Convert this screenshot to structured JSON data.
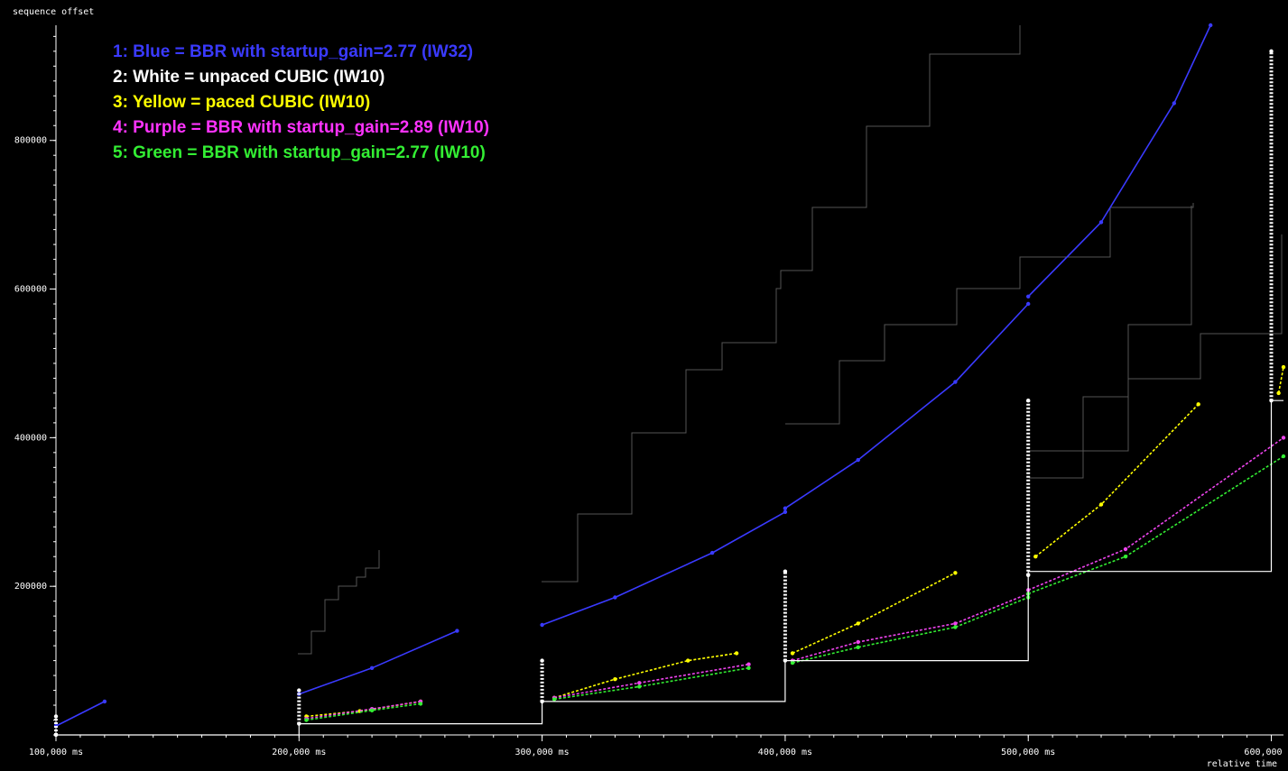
{
  "chart_data": {
    "type": "line",
    "title": "",
    "ylabel": "sequence offset",
    "xlabel": "relative time",
    "xlim": [
      100000,
      605000
    ],
    "ylim": [
      0,
      955000
    ],
    "x_ticks": [
      {
        "value": 100000,
        "label": "100,000 ms"
      },
      {
        "value": 200000,
        "label": "200,000 ms"
      },
      {
        "value": 300000,
        "label": "300,000 ms"
      },
      {
        "value": 400000,
        "label": "400,000 ms"
      },
      {
        "value": 500000,
        "label": "500,000 ms"
      },
      {
        "value": 600000,
        "label": "600,000 ms"
      }
    ],
    "y_ticks": [
      {
        "value": 200000,
        "label": "200000"
      },
      {
        "value": 400000,
        "label": "400000"
      },
      {
        "value": 600000,
        "label": "600000"
      },
      {
        "value": 800000,
        "label": "800000"
      }
    ],
    "legend": [
      {
        "text": "1: Blue = BBR with startup_gain=2.77 (IW32)",
        "color": "#4040ff"
      },
      {
        "text": "2: White = unpaced CUBIC (IW10)",
        "color": "#ffffff"
      },
      {
        "text": "3: Yellow = paced CUBIC (IW10)",
        "color": "#ffff00"
      },
      {
        "text": "4: Purple = BBR with startup_gain=2.89 (IW10)",
        "color": "#ff33ff"
      },
      {
        "text": "5: Green = BBR with startup_gain=2.77 (IW10)",
        "color": "#33ee33"
      }
    ],
    "series": [
      {
        "name": "1: Blue = BBR with startup_gain=2.77 (IW32)",
        "color": "#3a3aff",
        "segments": [
          [
            [
              100000,
              12000
            ],
            [
              120000,
              45000
            ]
          ],
          [
            [
              200000,
              55000
            ],
            [
              230000,
              90000
            ],
            [
              265000,
              140000
            ]
          ],
          [
            [
              300000,
              148000
            ],
            [
              330000,
              185000
            ],
            [
              370000,
              245000
            ],
            [
              400000,
              300000
            ]
          ],
          [
            [
              400000,
              305000
            ],
            [
              430000,
              370000
            ],
            [
              470000,
              475000
            ],
            [
              500000,
              580000
            ]
          ],
          [
            [
              500000,
              590000
            ],
            [
              530000,
              690000
            ],
            [
              560000,
              850000
            ],
            [
              575000,
              955000
            ]
          ]
        ]
      },
      {
        "name": "2: White = unpaced CUBIC (IW10)",
        "color": "#ffffff",
        "segments": [
          [
            [
              100000,
              0
            ],
            [
              100000,
              25000
            ]
          ],
          [
            [
              200000,
              15000
            ],
            [
              200000,
              60000
            ]
          ],
          [
            [
              300000,
              45000
            ],
            [
              300000,
              100000
            ]
          ],
          [
            [
              400000,
              100000
            ],
            [
              400000,
              220000
            ]
          ],
          [
            [
              500000,
              215000
            ],
            [
              500000,
              450000
            ]
          ],
          [
            [
              600000,
              450000
            ],
            [
              600000,
              920000
            ]
          ]
        ]
      },
      {
        "name": "3: Yellow = paced CUBIC (IW10)",
        "color": "#ffff00",
        "segments": [
          [
            [
              203000,
              25000
            ],
            [
              225000,
              32000
            ],
            [
              250000,
              45000
            ]
          ],
          [
            [
              305000,
              50000
            ],
            [
              330000,
              75000
            ],
            [
              360000,
              100000
            ],
            [
              380000,
              110000
            ]
          ],
          [
            [
              403000,
              110000
            ],
            [
              430000,
              150000
            ],
            [
              470000,
              218000
            ]
          ],
          [
            [
              503000,
              240000
            ],
            [
              530000,
              310000
            ],
            [
              570000,
              445000
            ]
          ],
          [
            [
              603000,
              460000
            ],
            [
              605000,
              495000
            ]
          ]
        ]
      },
      {
        "name": "4: Purple = BBR with startup_gain=2.89 (IW10)",
        "color": "#ee44ee",
        "segments": [
          [
            [
              203000,
              22000
            ],
            [
              230000,
              35000
            ],
            [
              250000,
              45000
            ]
          ],
          [
            [
              305000,
              50000
            ],
            [
              340000,
              70000
            ],
            [
              385000,
              95000
            ]
          ],
          [
            [
              403000,
              100000
            ],
            [
              430000,
              125000
            ],
            [
              470000,
              150000
            ],
            [
              500000,
              190000
            ]
          ],
          [
            [
              500000,
              195000
            ],
            [
              540000,
              250000
            ],
            [
              605000,
              400000
            ]
          ]
        ]
      },
      {
        "name": "5: Green = BBR with startup_gain=2.77 (IW10)",
        "color": "#33ee33",
        "segments": [
          [
            [
              203000,
              20000
            ],
            [
              230000,
              33000
            ],
            [
              250000,
              42000
            ]
          ],
          [
            [
              305000,
              48000
            ],
            [
              340000,
              65000
            ],
            [
              385000,
              90000
            ]
          ],
          [
            [
              403000,
              97000
            ],
            [
              430000,
              118000
            ],
            [
              470000,
              145000
            ],
            [
              500000,
              185000
            ]
          ],
          [
            [
              500000,
              190000
            ],
            [
              540000,
              240000
            ],
            [
              605000,
              375000
            ]
          ]
        ]
      }
    ]
  }
}
